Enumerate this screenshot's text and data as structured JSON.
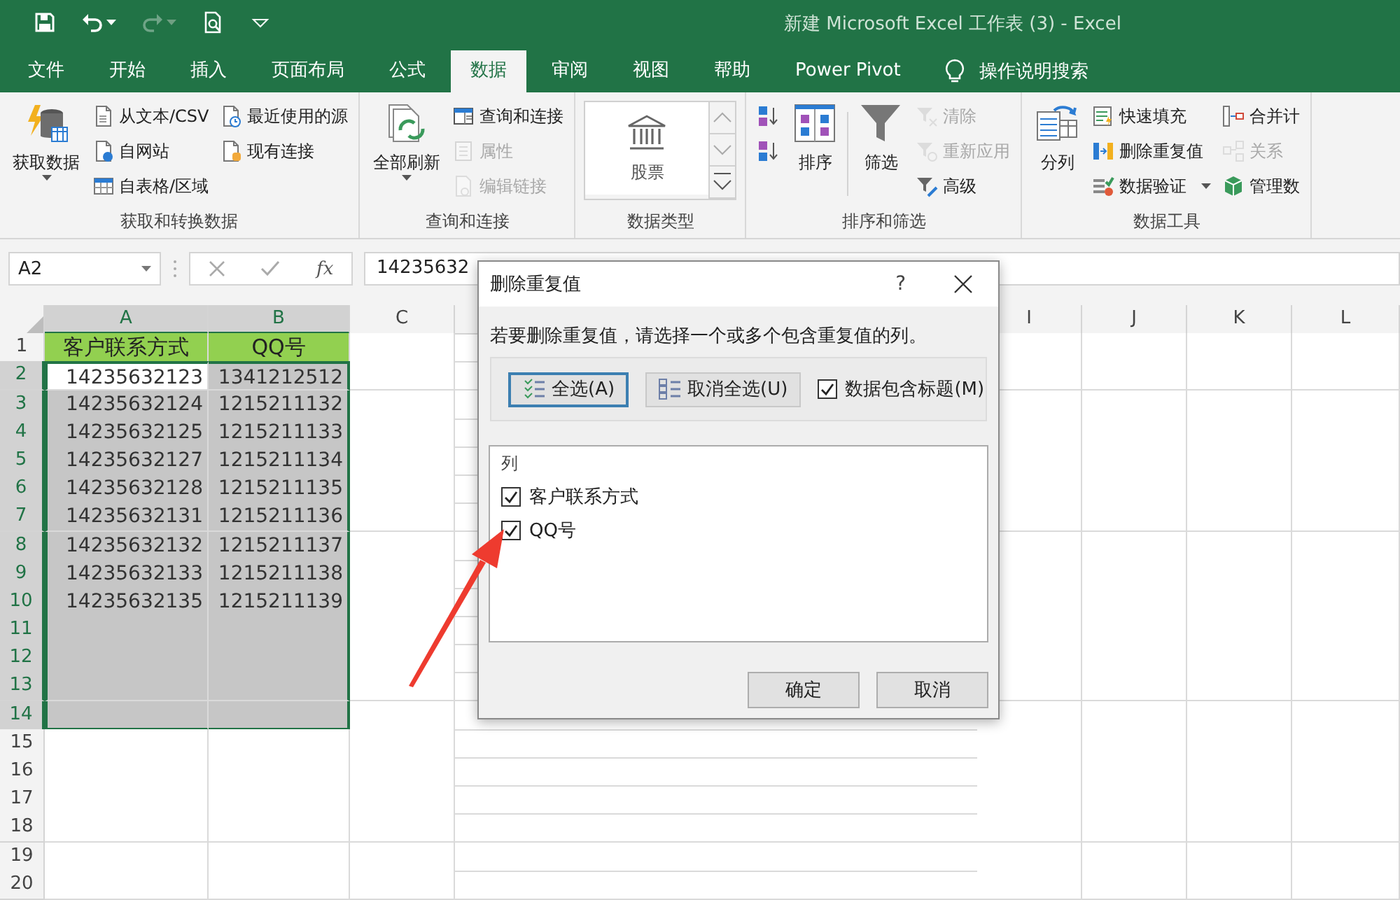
{
  "window": {
    "title": "新建 Microsoft Excel 工作表 (3)  -  Excel"
  },
  "quick_access": [
    {
      "kind": "save",
      "disabled": false,
      "dropdown": false
    },
    {
      "kind": "undo",
      "disabled": false,
      "dropdown": true
    },
    {
      "kind": "redo",
      "disabled": true,
      "dropdown": true
    },
    {
      "kind": "preview",
      "disabled": false,
      "dropdown": false
    },
    {
      "kind": "customize",
      "disabled": false,
      "dropdown": false
    }
  ],
  "tabs": [
    {
      "label": "文件",
      "selected": false
    },
    {
      "label": "开始",
      "selected": false
    },
    {
      "label": "插入",
      "selected": false
    },
    {
      "label": "页面布局",
      "selected": false
    },
    {
      "label": "公式",
      "selected": false
    },
    {
      "label": "数据",
      "selected": true
    },
    {
      "label": "审阅",
      "selected": false
    },
    {
      "label": "视图",
      "selected": false
    },
    {
      "label": "帮助",
      "selected": false
    },
    {
      "label": "Power Pivot",
      "selected": false
    }
  ],
  "tell_me": {
    "label": "操作说明搜索"
  },
  "ribbon": {
    "groups": [
      {
        "label": "获取和转换数据",
        "sections": [
          {
            "kind": "large",
            "label": "获取数据",
            "dropdown": true
          },
          {
            "kind": "column",
            "items": [
              {
                "label": "从文本/CSV",
                "disabled": false
              },
              {
                "label": "自网站",
                "disabled": false
              },
              {
                "label": "自表格/区域",
                "disabled": false
              }
            ]
          },
          {
            "kind": "column",
            "items": [
              {
                "label": "最近使用的源",
                "disabled": false
              },
              {
                "label": "现有连接",
                "disabled": false
              }
            ]
          }
        ]
      },
      {
        "label": "查询和连接",
        "sections": [
          {
            "kind": "large",
            "label": "全部刷新",
            "dropdown": true
          },
          {
            "kind": "column",
            "items": [
              {
                "label": "查询和连接",
                "disabled": false
              },
              {
                "label": "属性",
                "disabled": true
              },
              {
                "label": "编辑链接",
                "disabled": true
              }
            ]
          }
        ]
      },
      {
        "label": "数据类型",
        "sections": [
          {
            "kind": "gallery",
            "label": "股票"
          }
        ]
      },
      {
        "label": "排序和筛选",
        "sections": [
          {
            "kind": "column",
            "items": [
              {
                "disabled": false
              },
              {
                "disabled": false
              }
            ]
          },
          {
            "kind": "large",
            "label": "排序",
            "dropdown": false
          },
          {
            "kind": "divider"
          },
          {
            "kind": "large",
            "label": "筛选",
            "dropdown": false
          },
          {
            "kind": "column",
            "items": [
              {
                "label": "清除",
                "disabled": true
              },
              {
                "label": "重新应用",
                "disabled": true
              },
              {
                "label": "高级",
                "disabled": false
              }
            ]
          }
        ]
      },
      {
        "label": "数据工具",
        "sections": [
          {
            "kind": "large",
            "label": "分列",
            "dropdown": false
          },
          {
            "kind": "column",
            "items": [
              {
                "label": "快速填充",
                "disabled": false
              },
              {
                "label": "删除重复值",
                "disabled": false
              },
              {
                "label": "数据验证",
                "disabled": false,
                "dropdown": true
              }
            ]
          },
          {
            "kind": "column",
            "items": [
              {
                "label": "合并计",
                "disabled": false
              },
              {
                "label": "关系",
                "disabled": true
              },
              {
                "label": "管理数",
                "disabled": false
              }
            ]
          }
        ]
      }
    ]
  },
  "formula_bar": {
    "name_box": "A2",
    "function_label": "fx",
    "value": "14235632"
  },
  "sheet": {
    "columns": [
      {
        "label": "A",
        "covered": false,
        "selected": true
      },
      {
        "label": "B",
        "covered": false,
        "selected": true
      },
      {
        "label": "C",
        "covered": false,
        "selected": false
      },
      {
        "covered": true
      },
      {
        "label": "I",
        "covered": false,
        "selected": false
      },
      {
        "label": "J",
        "covered": false,
        "selected": false
      },
      {
        "label": "K",
        "covered": false,
        "selected": false
      },
      {
        "label": "L",
        "covered": false,
        "selected": false
      }
    ],
    "rows": [
      {
        "number": "1",
        "selected": false,
        "cells": [
          {
            "text": "客户联系方式",
            "kind": "header",
            "selected": false,
            "active": false
          },
          {
            "text": "QQ号",
            "kind": "header",
            "selected": false,
            "active": false
          }
        ]
      },
      {
        "number": "2",
        "selected": true,
        "cells": [
          {
            "text": "14235632123",
            "kind": "number",
            "selected": true,
            "active": true
          },
          {
            "text": "1341212512",
            "kind": "number",
            "selected": true,
            "active": false
          }
        ]
      },
      {
        "number": "3",
        "selected": true,
        "cells": [
          {
            "text": "14235632124",
            "kind": "number",
            "selected": true,
            "active": false
          },
          {
            "text": "1215211132",
            "kind": "number",
            "selected": true,
            "active": false
          }
        ]
      },
      {
        "number": "4",
        "selected": true,
        "cells": [
          {
            "text": "14235632125",
            "kind": "number",
            "selected": true,
            "active": false
          },
          {
            "text": "1215211133",
            "kind": "number",
            "selected": true,
            "active": false
          }
        ]
      },
      {
        "number": "5",
        "selected": true,
        "cells": [
          {
            "text": "14235632127",
            "kind": "number",
            "selected": true,
            "active": false
          },
          {
            "text": "1215211134",
            "kind": "number",
            "selected": true,
            "active": false
          }
        ]
      },
      {
        "number": "6",
        "selected": true,
        "cells": [
          {
            "text": "14235632128",
            "kind": "number",
            "selected": true,
            "active": false
          },
          {
            "text": "1215211135",
            "kind": "number",
            "selected": true,
            "active": false
          }
        ]
      },
      {
        "number": "7",
        "selected": true,
        "cells": [
          {
            "text": "14235632131",
            "kind": "number",
            "selected": true,
            "active": false
          },
          {
            "text": "1215211136",
            "kind": "number",
            "selected": true,
            "active": false
          }
        ]
      },
      {
        "number": "8",
        "selected": true,
        "cells": [
          {
            "text": "14235632132",
            "kind": "number",
            "selected": true,
            "active": false
          },
          {
            "text": "1215211137",
            "kind": "number",
            "selected": true,
            "active": false
          }
        ]
      },
      {
        "number": "9",
        "selected": true,
        "cells": [
          {
            "text": "14235632133",
            "kind": "number",
            "selected": true,
            "active": false
          },
          {
            "text": "1215211138",
            "kind": "number",
            "selected": true,
            "active": false
          }
        ]
      },
      {
        "number": "10",
        "selected": true,
        "cells": [
          {
            "text": "14235632135",
            "kind": "number",
            "selected": true,
            "active": false
          },
          {
            "text": "1215211139",
            "kind": "number",
            "selected": true,
            "active": false
          }
        ]
      },
      {
        "number": "11",
        "selected": true,
        "cells": [
          {
            "kind": "empty",
            "selected": true,
            "active": false
          },
          {
            "kind": "empty",
            "selected": true,
            "active": false
          }
        ]
      },
      {
        "number": "12",
        "selected": true,
        "cells": [
          {
            "kind": "empty",
            "selected": true,
            "active": false
          },
          {
            "kind": "empty",
            "selected": true,
            "active": false
          }
        ]
      },
      {
        "number": "13",
        "selected": true,
        "cells": [
          {
            "kind": "empty",
            "selected": true,
            "active": false
          },
          {
            "kind": "empty",
            "selected": true,
            "active": false
          }
        ]
      },
      {
        "number": "14",
        "selected": true,
        "cells": [
          {
            "kind": "empty",
            "selected": true,
            "active": false
          },
          {
            "kind": "empty",
            "selected": true,
            "active": false
          }
        ]
      },
      {
        "number": "15",
        "selected": false
      },
      {
        "number": "16",
        "selected": false
      },
      {
        "number": "17",
        "selected": false
      },
      {
        "number": "18",
        "selected": false
      },
      {
        "number": "19",
        "selected": false
      },
      {
        "number": "20",
        "selected": false
      }
    ]
  },
  "dialog": {
    "title": "删除重复值",
    "help": "?",
    "instruction": "若要删除重复值，请选择一个或多个包含重复值的列。",
    "select_buttons": [
      {
        "label": "全选(A)",
        "focused": true
      },
      {
        "label": "取消全选(U)",
        "focused": false
      }
    ],
    "header_checkbox": {
      "label": "数据包含标题(M)",
      "checked": true
    },
    "list": {
      "heading": "列",
      "items": [
        {
          "label": "客户联系方式",
          "checked": true
        },
        {
          "label": "QQ号",
          "checked": true
        }
      ]
    },
    "buttons": [
      {
        "label": "确定"
      },
      {
        "label": "取消"
      }
    ]
  },
  "annotation": {
    "kind": "arrow"
  }
}
